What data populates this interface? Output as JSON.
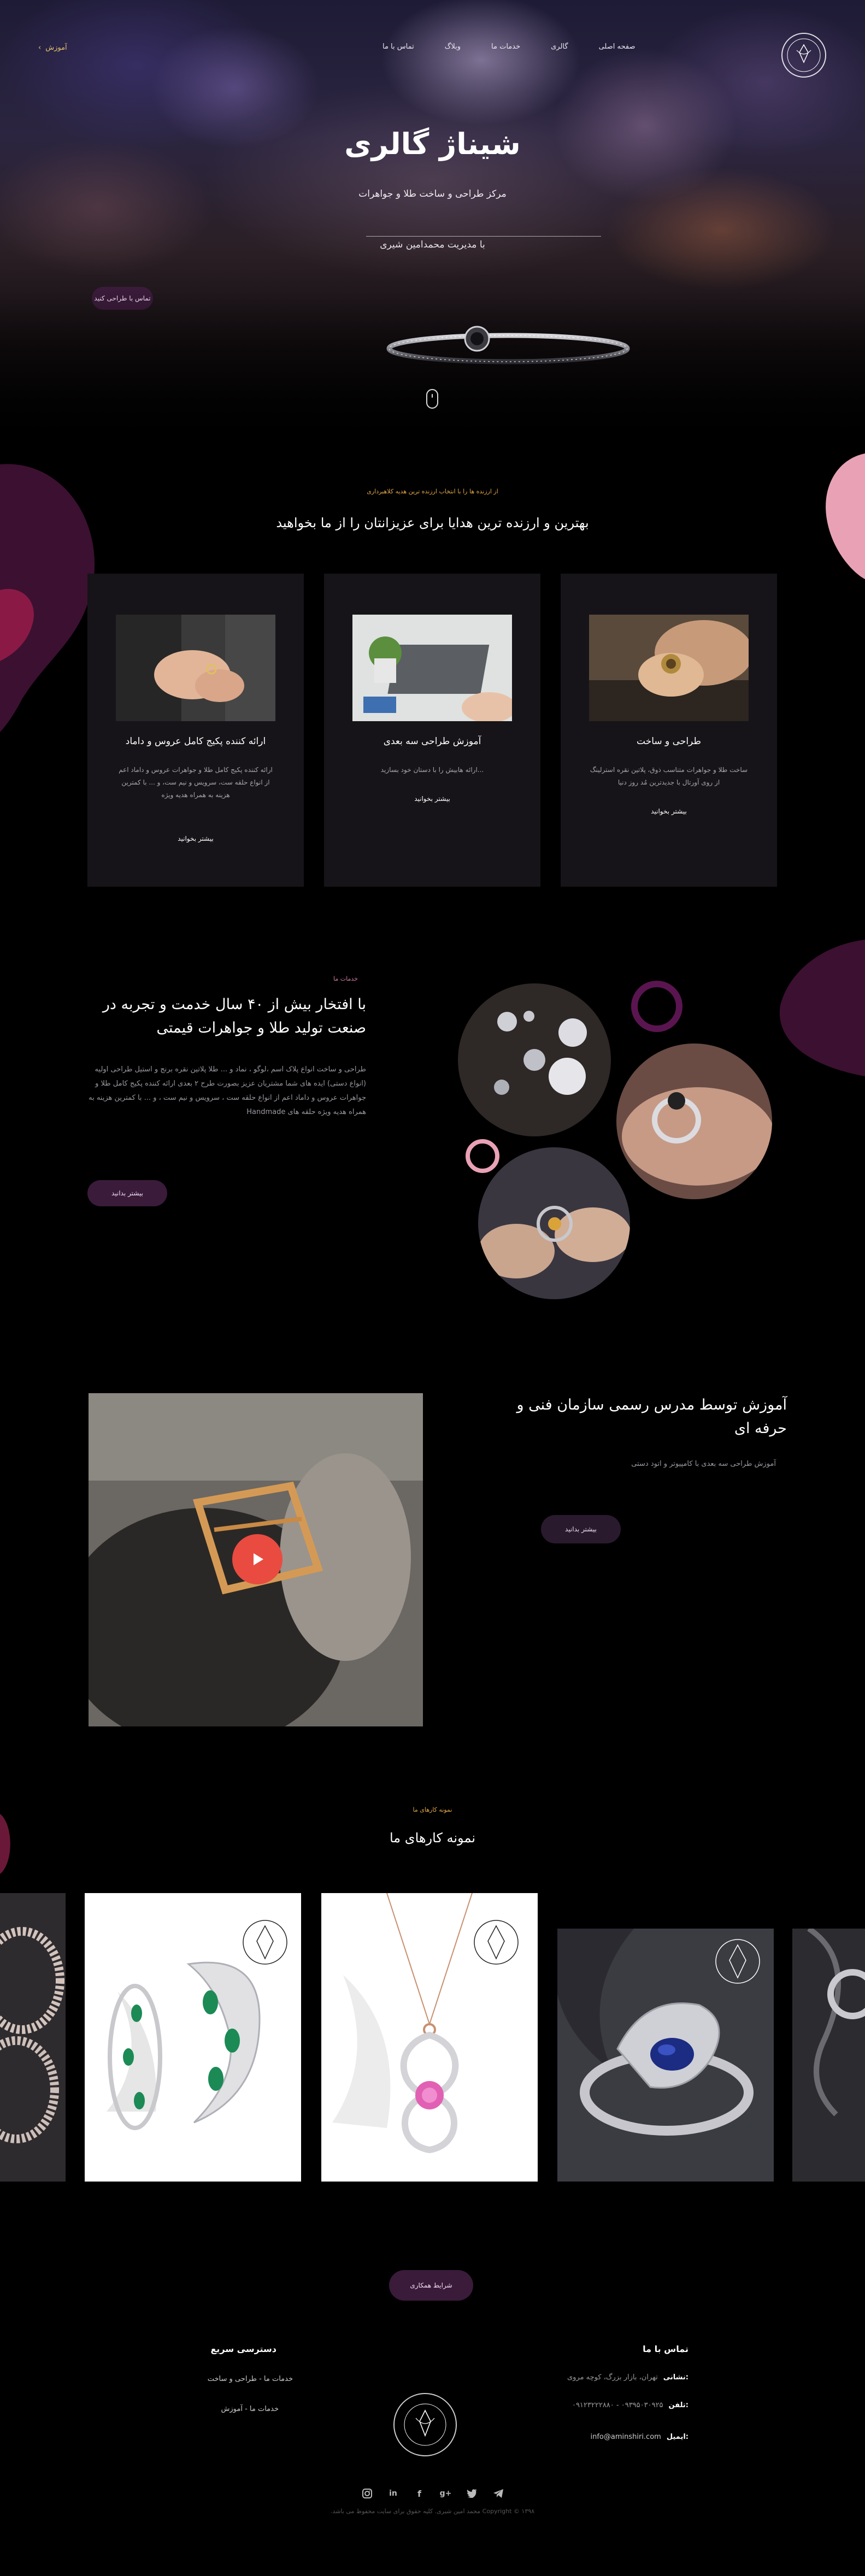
{
  "nav": {
    "logo": "SHINAJ JEWELLERY GROUP",
    "menu": [
      "صفحه اصلی",
      "گالری",
      "خدمات ما",
      "وبلاگ",
      "تماس با ما"
    ],
    "lang_link": "آموزش"
  },
  "hero": {
    "title": "شیناژ گالری",
    "subtitle": "مرکز طراحی و ساخت طلا و جواهرات",
    "manager": "با مدیریت محمدامین شیری",
    "button": "تماس با طراحی کنید"
  },
  "section_services": {
    "tag": "از ارزنده ها را با انتخاب ارزنده ترین هدیه کلاهبرداری",
    "title": "بهترین و ارزنده ترین هدایا برای عزیزانتان را از ما بخواهید",
    "cards": [
      {
        "title": "طراحی و ساخت",
        "text": "ساخت طلا و جواهرات متناسب ذوق، پلاتین نقره استرلینگ از روی آورتال با جدیدترین مُد روز دنیا",
        "link": "بیشتر بخوانید"
      },
      {
        "title": "آموزش طراحی سه بعدی",
        "text": "...ارائه هابیش را با دستان خود بسازید",
        "link": "بیشتر بخوانید"
      },
      {
        "title": "ارائه کننده پکیج کامل عروس و داماد",
        "text": "ارائه کننده پکیج کامل طلا و جواهرات عروس و داماد اعم از انواع حلقه ست، سرویس و نیم ست، و ... با کمترین هزینه به همراه هدیه ویژه",
        "link": "بیشتر بخوانید"
      }
    ]
  },
  "section_about": {
    "tag": "خدمات ما",
    "title": "با افتخار بیش از ۴۰ سال خدمت و تجربه در صنعت تولید طلا و جواهرات قیمتی",
    "text": "طراحی و ساخت انواع پلاک اسم ،لوگو ، نماد و ... طلا پلاتین نقره برنج و استیل طراحی اولیه (انواع دستی) ایده های شما مشتریان عزیز بصورت طرح ۲ بعدی ارائه کننده پکیج کامل طلا و جواهرات عروس و داماد اعم از انواع حلقه ست ، سرویس و نیم ست ، و ... با کمترین هزینه به همراه هدیه ویژه حلقه های Handmade",
    "button": "بیشتر بدانید"
  },
  "section_training": {
    "title": "آموزش توسط مدرس رسمی سازمان فنی و حرفه ای",
    "text": "آموزش طراحی سه بعدی با کامپیوتر و اتود دستی",
    "button": "بیشتر بدانید"
  },
  "section_portfolio": {
    "tag": "نمونه کارهای ما",
    "title": "نمونه کارهای ما",
    "watermark": "SHINAJ JEWELLERY GROUP"
  },
  "footer": {
    "coop_button": "شرایط همکاری",
    "contact_heading": "تماس با ما",
    "address_label": "نشانی:",
    "address_value": "تهران، بازار بزرگ، کوچه مروی",
    "phone_label": "تلفن:",
    "phone_value": "۰۹۱۲۳۲۲۲۸۸۰ - ۰۹۳۹۵۰۳۰۹۲۵",
    "email_label": "ایمیل:",
    "email_value": "info@aminshiri.com",
    "quick_heading": "دسترسی سریع",
    "quick_links": [
      "خدمات ما - طراحی و ساخت",
      "خدمات ما - آموزش"
    ],
    "logo": "SHINAJ JEWELLERY GROUP",
    "socials": [
      "telegram-icon",
      "twitter-icon",
      "google-plus-icon",
      "facebook-icon",
      "linkedin-icon",
      "instagram-icon"
    ],
    "copyright": "Copyright © ۱۳۹۸ محمد امین شیری. کلیه حقوق برای سایت محفوظ می باشد."
  },
  "colors": {
    "accent": "#3a1b3a",
    "gold": "#e4a94a",
    "pink": "#e9a2b5",
    "play": "#e94b40"
  }
}
